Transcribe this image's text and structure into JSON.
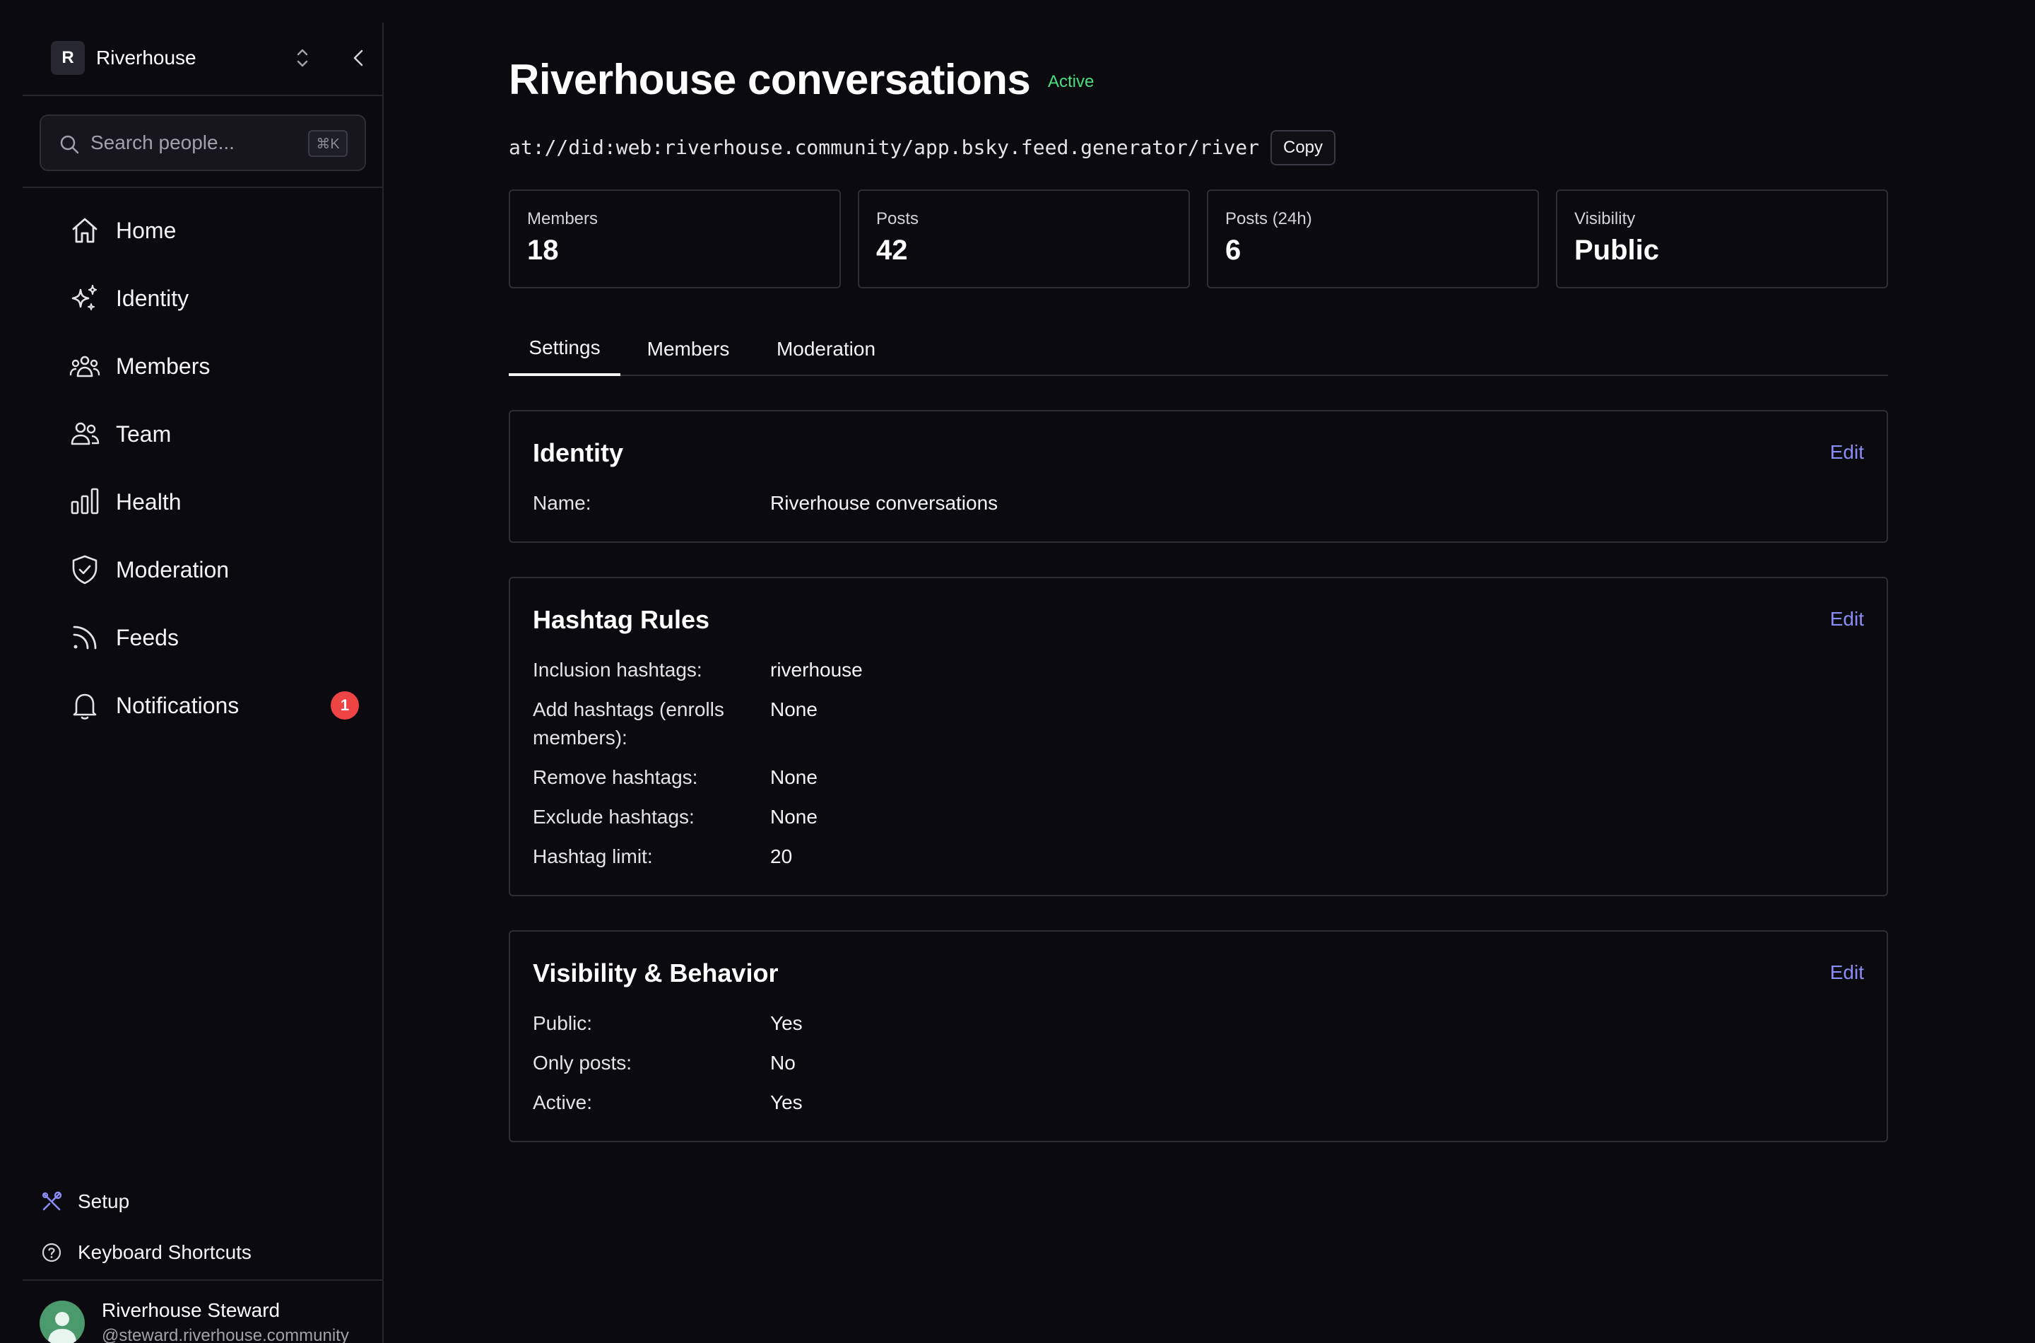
{
  "workspace": {
    "initial": "R",
    "name": "Riverhouse"
  },
  "search": {
    "placeholder": "Search people...",
    "shortcut": "⌘K"
  },
  "nav": [
    {
      "label": "Home",
      "icon": "home-icon"
    },
    {
      "label": "Identity",
      "icon": "sparkles-icon"
    },
    {
      "label": "Members",
      "icon": "users-icon"
    },
    {
      "label": "Team",
      "icon": "team-icon"
    },
    {
      "label": "Health",
      "icon": "bar-chart-icon"
    },
    {
      "label": "Moderation",
      "icon": "shield-check-icon"
    },
    {
      "label": "Feeds",
      "icon": "rss-icon"
    },
    {
      "label": "Notifications",
      "icon": "bell-icon",
      "badge": "1"
    }
  ],
  "bottom_links": {
    "setup": "Setup",
    "shortcuts": "Keyboard Shortcuts"
  },
  "user": {
    "name": "Riverhouse Steward",
    "handle": "@steward.riverhouse.community"
  },
  "page": {
    "title": "Riverhouse conversations",
    "status": "Active",
    "uri": "at://did:web:riverhouse.community/app.bsky.feed.generator/river",
    "copy_label": "Copy"
  },
  "stats": [
    {
      "label": "Members",
      "value": "18"
    },
    {
      "label": "Posts",
      "value": "42"
    },
    {
      "label": "Posts (24h)",
      "value": "6"
    },
    {
      "label": "Visibility",
      "value": "Public"
    }
  ],
  "tabs": [
    "Settings",
    "Members",
    "Moderation"
  ],
  "sections": {
    "identity": {
      "title": "Identity",
      "edit": "Edit",
      "rows": [
        {
          "label": "Name:",
          "value": "Riverhouse conversations"
        }
      ]
    },
    "hashtag": {
      "title": "Hashtag Rules",
      "edit": "Edit",
      "rows": [
        {
          "label": "Inclusion hashtags:",
          "value": "riverhouse"
        },
        {
          "label": "Add hashtags (enrolls members):",
          "value": "None"
        },
        {
          "label": "Remove hashtags:",
          "value": "None"
        },
        {
          "label": "Exclude hashtags:",
          "value": "None"
        },
        {
          "label": "Hashtag limit:",
          "value": "20"
        }
      ]
    },
    "visibility": {
      "title": "Visibility & Behavior",
      "edit": "Edit",
      "rows": [
        {
          "label": "Public:",
          "value": "Yes"
        },
        {
          "label": "Only posts:",
          "value": "No"
        },
        {
          "label": "Active:",
          "value": "Yes"
        }
      ]
    }
  },
  "colors": {
    "accent": "#8b8cf5",
    "status_active": "#4ade80",
    "badge": "#ef4444",
    "background": "#0a0a0f"
  }
}
